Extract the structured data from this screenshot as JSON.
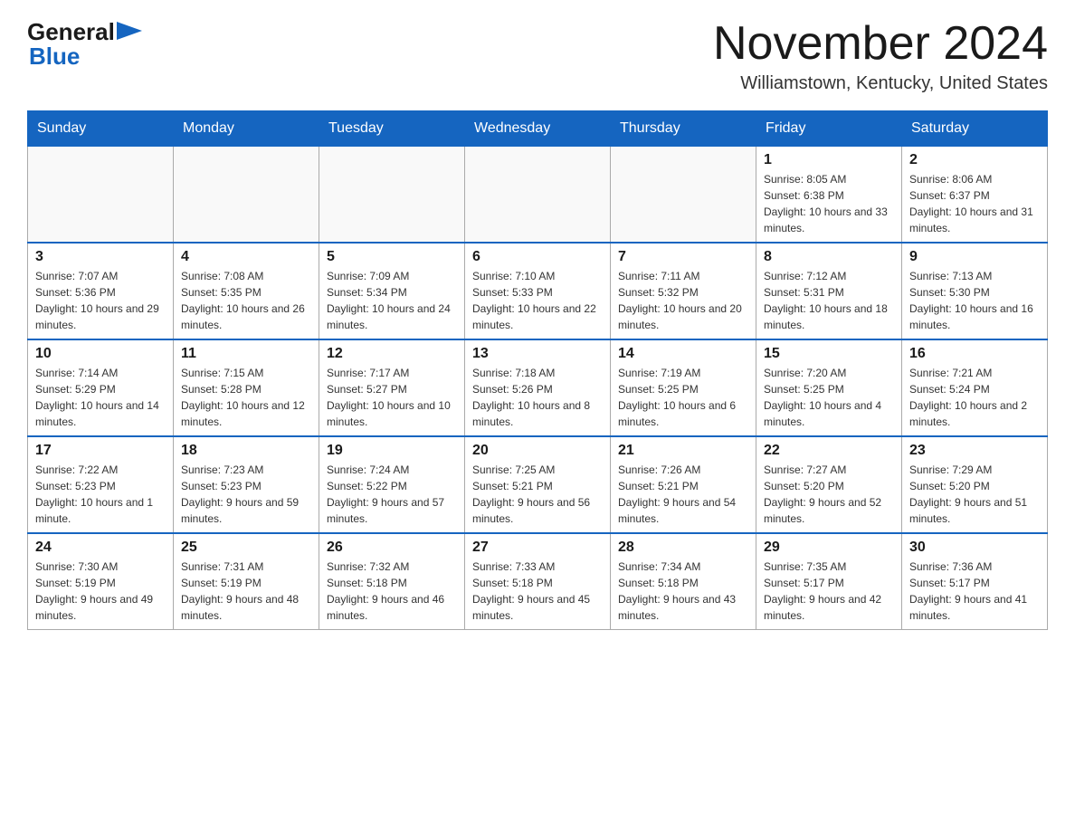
{
  "logo": {
    "general": "General",
    "blue": "Blue"
  },
  "header": {
    "title": "November 2024",
    "location": "Williamstown, Kentucky, United States"
  },
  "weekdays": [
    "Sunday",
    "Monday",
    "Tuesday",
    "Wednesday",
    "Thursday",
    "Friday",
    "Saturday"
  ],
  "weeks": [
    [
      {
        "day": "",
        "sunrise": "",
        "sunset": "",
        "daylight": ""
      },
      {
        "day": "",
        "sunrise": "",
        "sunset": "",
        "daylight": ""
      },
      {
        "day": "",
        "sunrise": "",
        "sunset": "",
        "daylight": ""
      },
      {
        "day": "",
        "sunrise": "",
        "sunset": "",
        "daylight": ""
      },
      {
        "day": "",
        "sunrise": "",
        "sunset": "",
        "daylight": ""
      },
      {
        "day": "1",
        "sunrise": "Sunrise: 8:05 AM",
        "sunset": "Sunset: 6:38 PM",
        "daylight": "Daylight: 10 hours and 33 minutes."
      },
      {
        "day": "2",
        "sunrise": "Sunrise: 8:06 AM",
        "sunset": "Sunset: 6:37 PM",
        "daylight": "Daylight: 10 hours and 31 minutes."
      }
    ],
    [
      {
        "day": "3",
        "sunrise": "Sunrise: 7:07 AM",
        "sunset": "Sunset: 5:36 PM",
        "daylight": "Daylight: 10 hours and 29 minutes."
      },
      {
        "day": "4",
        "sunrise": "Sunrise: 7:08 AM",
        "sunset": "Sunset: 5:35 PM",
        "daylight": "Daylight: 10 hours and 26 minutes."
      },
      {
        "day": "5",
        "sunrise": "Sunrise: 7:09 AM",
        "sunset": "Sunset: 5:34 PM",
        "daylight": "Daylight: 10 hours and 24 minutes."
      },
      {
        "day": "6",
        "sunrise": "Sunrise: 7:10 AM",
        "sunset": "Sunset: 5:33 PM",
        "daylight": "Daylight: 10 hours and 22 minutes."
      },
      {
        "day": "7",
        "sunrise": "Sunrise: 7:11 AM",
        "sunset": "Sunset: 5:32 PM",
        "daylight": "Daylight: 10 hours and 20 minutes."
      },
      {
        "day": "8",
        "sunrise": "Sunrise: 7:12 AM",
        "sunset": "Sunset: 5:31 PM",
        "daylight": "Daylight: 10 hours and 18 minutes."
      },
      {
        "day": "9",
        "sunrise": "Sunrise: 7:13 AM",
        "sunset": "Sunset: 5:30 PM",
        "daylight": "Daylight: 10 hours and 16 minutes."
      }
    ],
    [
      {
        "day": "10",
        "sunrise": "Sunrise: 7:14 AM",
        "sunset": "Sunset: 5:29 PM",
        "daylight": "Daylight: 10 hours and 14 minutes."
      },
      {
        "day": "11",
        "sunrise": "Sunrise: 7:15 AM",
        "sunset": "Sunset: 5:28 PM",
        "daylight": "Daylight: 10 hours and 12 minutes."
      },
      {
        "day": "12",
        "sunrise": "Sunrise: 7:17 AM",
        "sunset": "Sunset: 5:27 PM",
        "daylight": "Daylight: 10 hours and 10 minutes."
      },
      {
        "day": "13",
        "sunrise": "Sunrise: 7:18 AM",
        "sunset": "Sunset: 5:26 PM",
        "daylight": "Daylight: 10 hours and 8 minutes."
      },
      {
        "day": "14",
        "sunrise": "Sunrise: 7:19 AM",
        "sunset": "Sunset: 5:25 PM",
        "daylight": "Daylight: 10 hours and 6 minutes."
      },
      {
        "day": "15",
        "sunrise": "Sunrise: 7:20 AM",
        "sunset": "Sunset: 5:25 PM",
        "daylight": "Daylight: 10 hours and 4 minutes."
      },
      {
        "day": "16",
        "sunrise": "Sunrise: 7:21 AM",
        "sunset": "Sunset: 5:24 PM",
        "daylight": "Daylight: 10 hours and 2 minutes."
      }
    ],
    [
      {
        "day": "17",
        "sunrise": "Sunrise: 7:22 AM",
        "sunset": "Sunset: 5:23 PM",
        "daylight": "Daylight: 10 hours and 1 minute."
      },
      {
        "day": "18",
        "sunrise": "Sunrise: 7:23 AM",
        "sunset": "Sunset: 5:23 PM",
        "daylight": "Daylight: 9 hours and 59 minutes."
      },
      {
        "day": "19",
        "sunrise": "Sunrise: 7:24 AM",
        "sunset": "Sunset: 5:22 PM",
        "daylight": "Daylight: 9 hours and 57 minutes."
      },
      {
        "day": "20",
        "sunrise": "Sunrise: 7:25 AM",
        "sunset": "Sunset: 5:21 PM",
        "daylight": "Daylight: 9 hours and 56 minutes."
      },
      {
        "day": "21",
        "sunrise": "Sunrise: 7:26 AM",
        "sunset": "Sunset: 5:21 PM",
        "daylight": "Daylight: 9 hours and 54 minutes."
      },
      {
        "day": "22",
        "sunrise": "Sunrise: 7:27 AM",
        "sunset": "Sunset: 5:20 PM",
        "daylight": "Daylight: 9 hours and 52 minutes."
      },
      {
        "day": "23",
        "sunrise": "Sunrise: 7:29 AM",
        "sunset": "Sunset: 5:20 PM",
        "daylight": "Daylight: 9 hours and 51 minutes."
      }
    ],
    [
      {
        "day": "24",
        "sunrise": "Sunrise: 7:30 AM",
        "sunset": "Sunset: 5:19 PM",
        "daylight": "Daylight: 9 hours and 49 minutes."
      },
      {
        "day": "25",
        "sunrise": "Sunrise: 7:31 AM",
        "sunset": "Sunset: 5:19 PM",
        "daylight": "Daylight: 9 hours and 48 minutes."
      },
      {
        "day": "26",
        "sunrise": "Sunrise: 7:32 AM",
        "sunset": "Sunset: 5:18 PM",
        "daylight": "Daylight: 9 hours and 46 minutes."
      },
      {
        "day": "27",
        "sunrise": "Sunrise: 7:33 AM",
        "sunset": "Sunset: 5:18 PM",
        "daylight": "Daylight: 9 hours and 45 minutes."
      },
      {
        "day": "28",
        "sunrise": "Sunrise: 7:34 AM",
        "sunset": "Sunset: 5:18 PM",
        "daylight": "Daylight: 9 hours and 43 minutes."
      },
      {
        "day": "29",
        "sunrise": "Sunrise: 7:35 AM",
        "sunset": "Sunset: 5:17 PM",
        "daylight": "Daylight: 9 hours and 42 minutes."
      },
      {
        "day": "30",
        "sunrise": "Sunrise: 7:36 AM",
        "sunset": "Sunset: 5:17 PM",
        "daylight": "Daylight: 9 hours and 41 minutes."
      }
    ]
  ]
}
